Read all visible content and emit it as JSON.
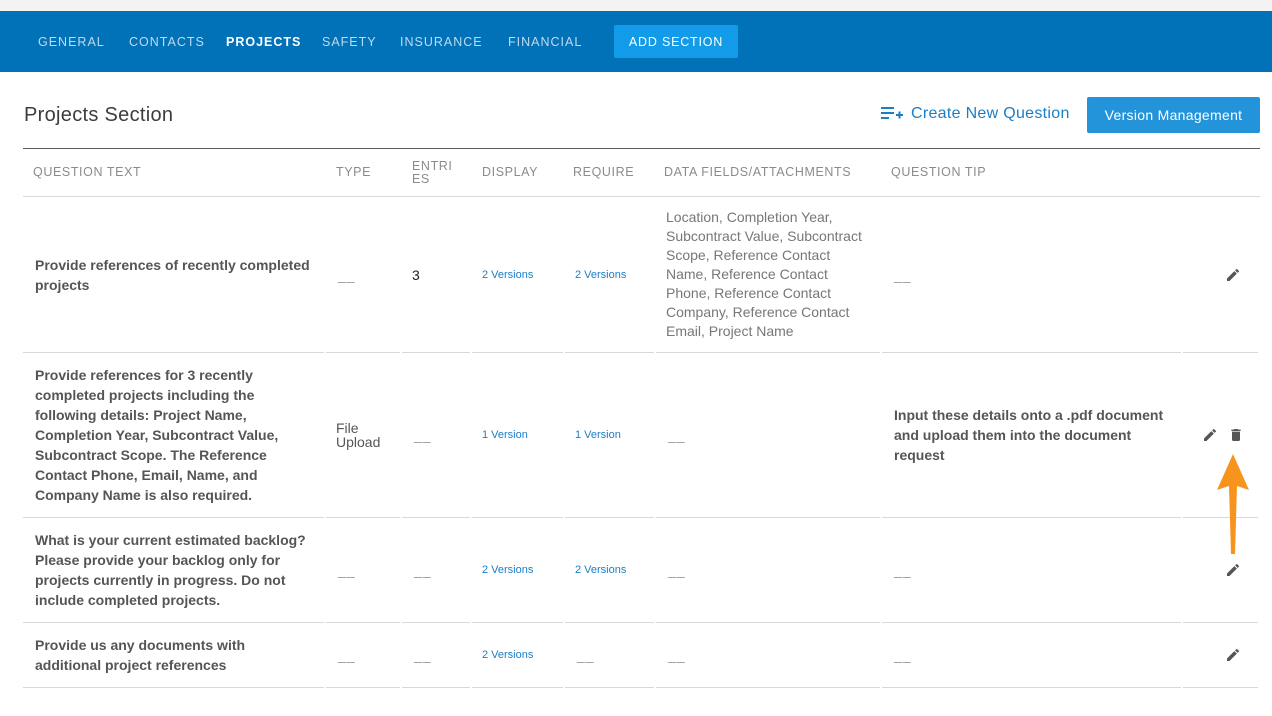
{
  "nav": {
    "tabs": [
      {
        "label": "GENERAL"
      },
      {
        "label": "CONTACTS"
      },
      {
        "label": "PROJECTS"
      },
      {
        "label": "SAFETY"
      },
      {
        "label": "INSURANCE"
      },
      {
        "label": "FINANCIAL"
      }
    ],
    "active_tab": "PROJECTS",
    "add_section_label": "ADD SECTION"
  },
  "section": {
    "title": "Projects Section",
    "create_question_label": "Create New Question",
    "version_management_label": "Version Management"
  },
  "table": {
    "headers": {
      "question_text": "QUESTION TEXT",
      "type": "TYPE",
      "entries": "ENTRI ES",
      "display": "DISPLAY",
      "require": "REQUIRE",
      "data_fields": "DATA FIELDS/ATTACHMENTS",
      "question_tip": "QUESTION TIP"
    },
    "rows": [
      {
        "question": "Provide references of recently completed projects",
        "type": "__",
        "entries": "3",
        "display": "2 Versions",
        "require": "2 Versions",
        "data_fields": "Location, Completion Year, Subcontract Value, Subcontract Scope, Reference Contact Name, Reference Contact Phone, Reference Contact Company, Reference Contact Email, Project Name",
        "tip": "__"
      },
      {
        "question": "Provide references for 3 recently completed projects including the following details: Project Name, Completion Year, Subcontract Value, Subcontract Scope. The Reference Contact Phone, Email, Name, and Company Name is also required.",
        "type": "File Upload",
        "entries": "__",
        "display": "1 Version",
        "require": "1 Version",
        "data_fields": "__",
        "tip": "Input these details onto a .pdf document and upload them into the document request"
      },
      {
        "question": "What is your current estimated backlog? Please provide your backlog only for projects currently in progress. Do not include completed projects.",
        "type": "__",
        "entries": "__",
        "display": "2 Versions",
        "require": "2 Versions",
        "data_fields": "__",
        "tip": "__"
      },
      {
        "question": "Provide us any documents with additional project references",
        "type": "__",
        "entries": "__",
        "display": "2 Versions",
        "require": "__",
        "data_fields": "__",
        "tip": "__"
      }
    ]
  },
  "icons": {
    "edit": "pencil-icon",
    "delete": "trash-icon",
    "create": "playlist-add-icon"
  },
  "colors": {
    "nav_bg": "#0272b8",
    "add_section_bg": "#129be8",
    "link": "#1a7ec4",
    "arrow": "#f7941d"
  }
}
